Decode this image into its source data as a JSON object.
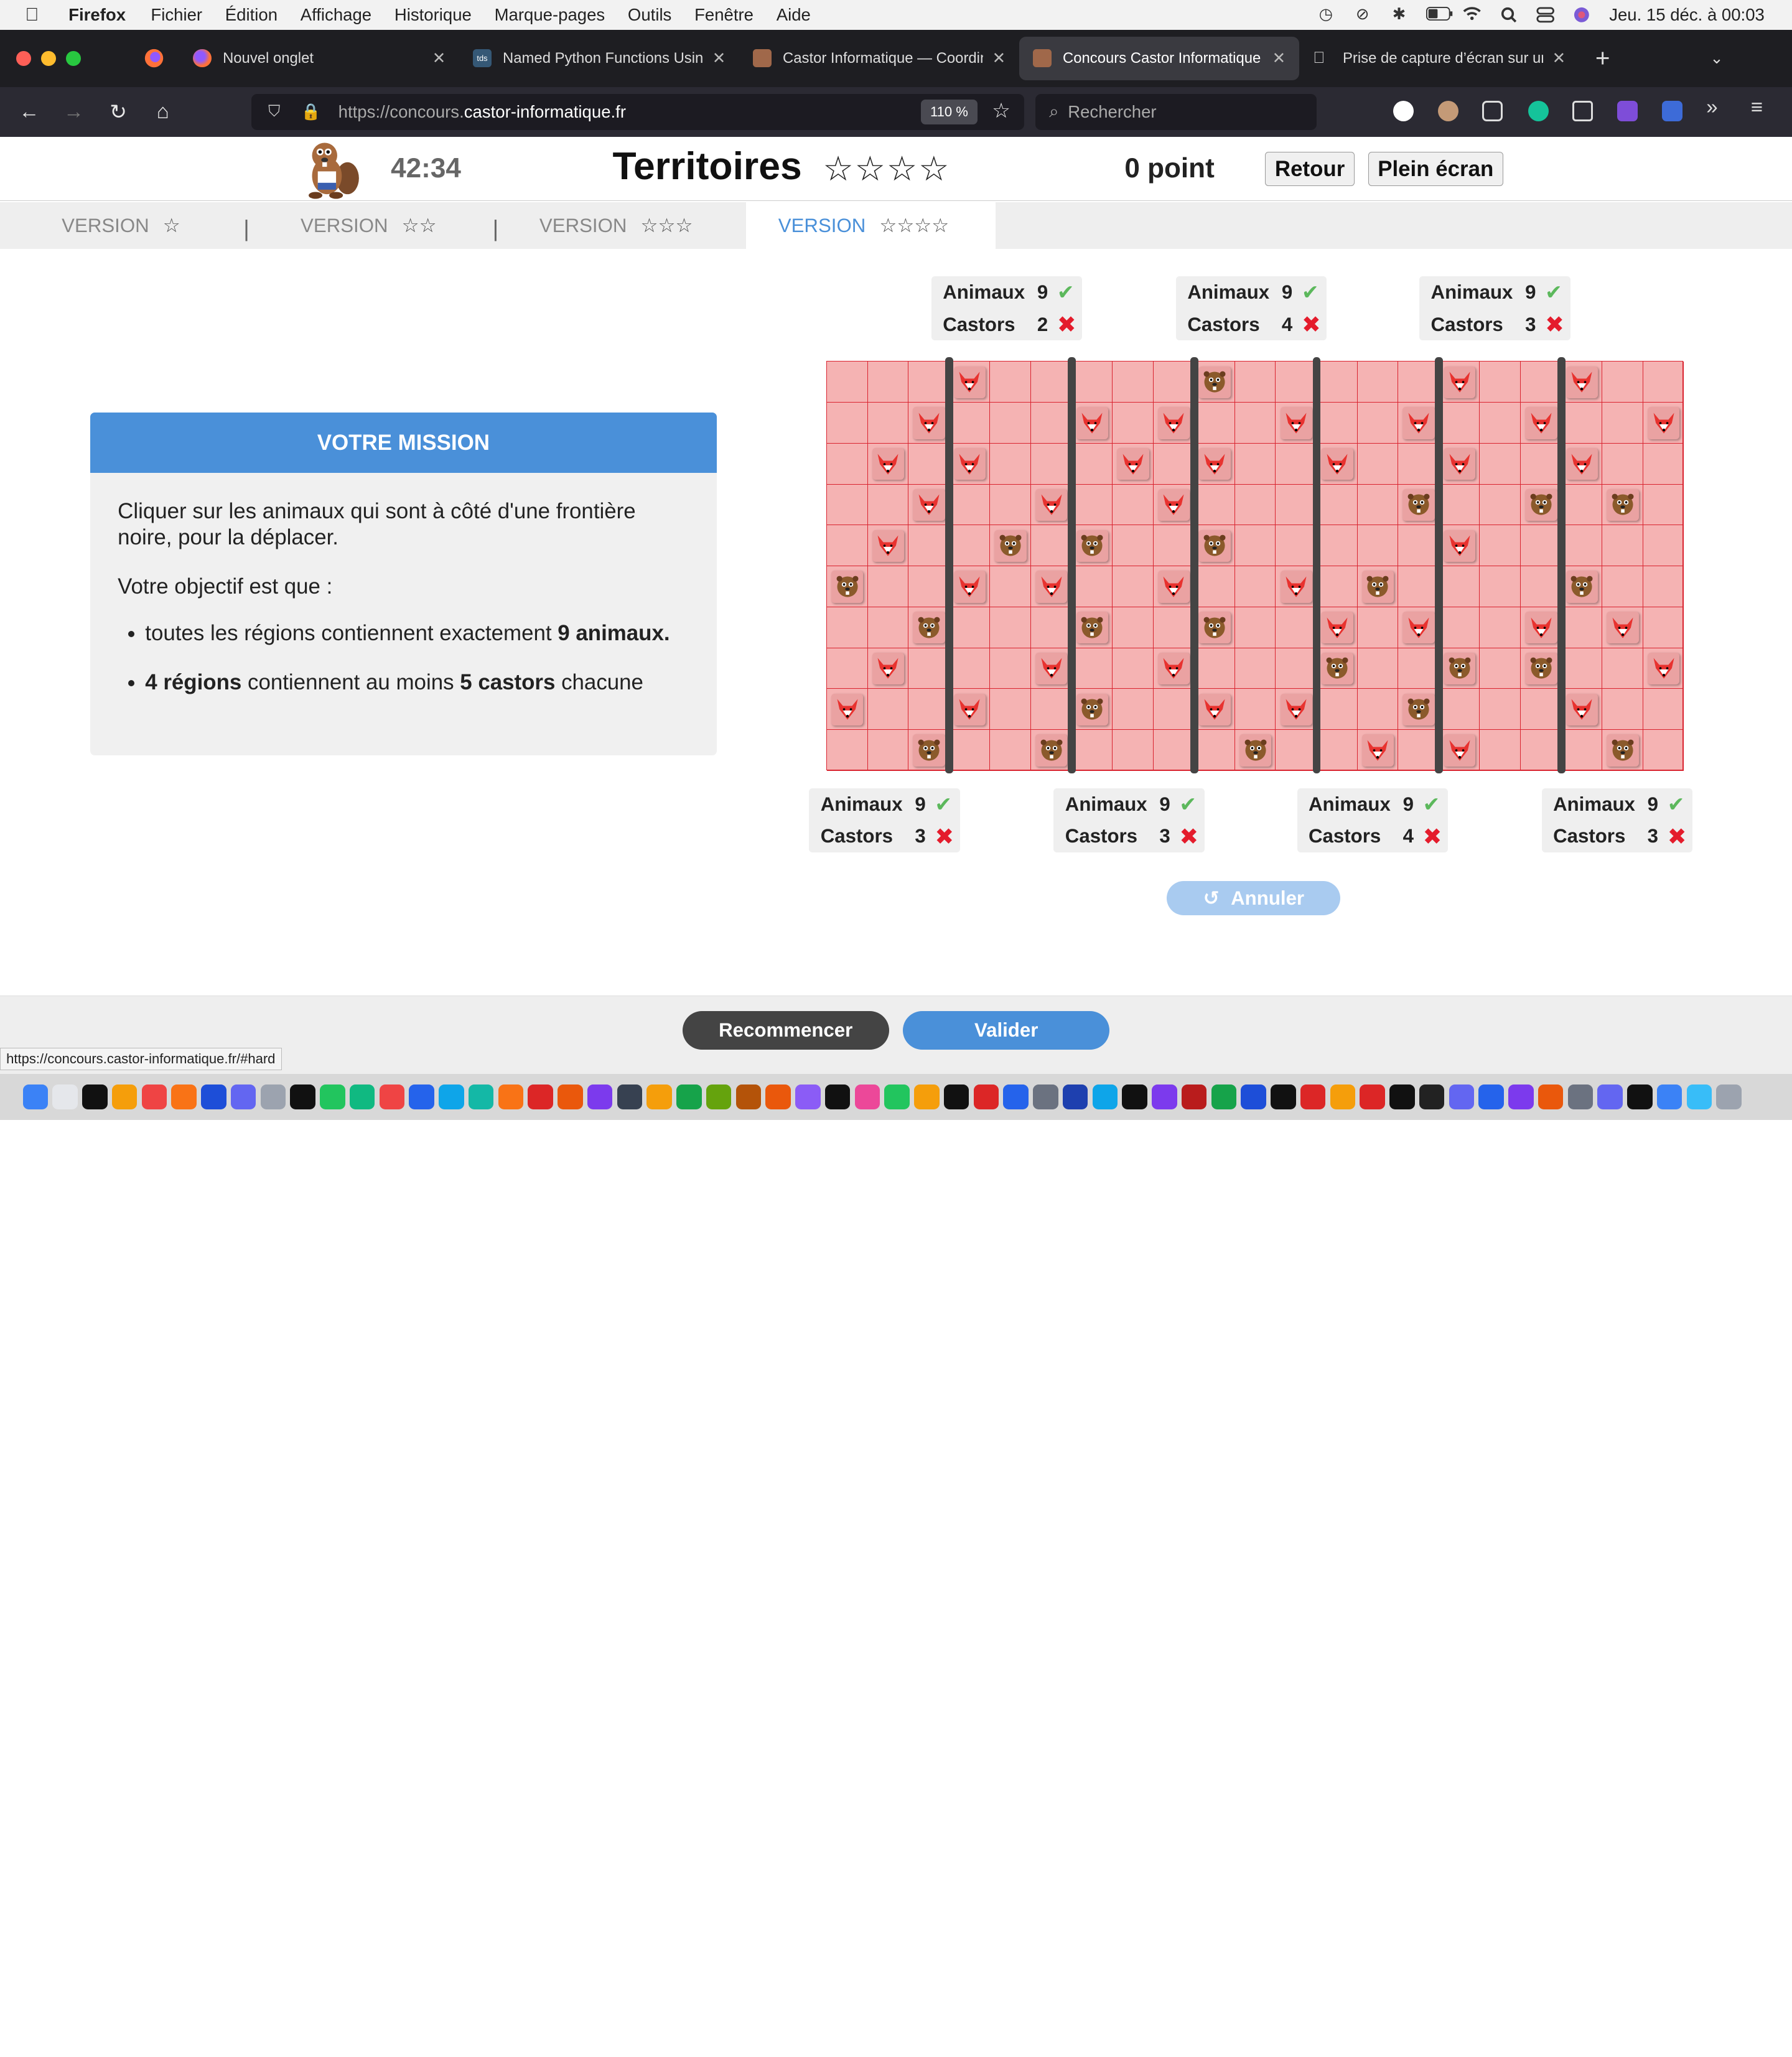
{
  "menubar": {
    "app": "Firefox",
    "items": [
      "Fichier",
      "Édition",
      "Affichage",
      "Historique",
      "Marque-pages",
      "Outils",
      "Fenêtre",
      "Aide"
    ],
    "clock": "Jeu. 15 déc. à  00:03"
  },
  "tabs": [
    {
      "title": "Nouvel onglet",
      "icon": "firefox-icon"
    },
    {
      "title": "Named Python Functions Using",
      "icon": "tds-icon"
    },
    {
      "title": "Castor Informatique — Coordina",
      "icon": "castor-icon"
    },
    {
      "title": "Concours Castor Informatique –",
      "icon": "castor-icon",
      "active": true
    },
    {
      "title": "Prise de capture d’écran sur un",
      "icon": "apple-icon"
    }
  ],
  "navbar": {
    "url_prefix": "https://concours.",
    "url_domain": "castor-informatique.fr",
    "zoom": "110 %",
    "search_placeholder": "Rechercher"
  },
  "header": {
    "timer": "42:34",
    "title": "Territoires",
    "stars": "☆☆☆☆",
    "score": "0 point",
    "back_label": "Retour",
    "fullscreen_label": "Plein écran"
  },
  "version_tabs": [
    {
      "label": "VERSION",
      "stars": "☆"
    },
    {
      "label": "VERSION",
      "stars": "☆☆"
    },
    {
      "label": "VERSION",
      "stars": "☆☆☆"
    },
    {
      "label": "VERSION",
      "stars": "☆☆☆☆",
      "active": true
    }
  ],
  "version_separator": "|",
  "mission": {
    "heading": "VOTRE MISSION",
    "intro": "Cliquer sur les animaux qui sont à côté d'une frontière noire, pour la déplacer.",
    "objective": "Votre objectif est que :",
    "bullet1_a": "toutes les régions contiennent exactement ",
    "bullet1_b": "9 animaux.",
    "bullet2_a": "4 régions",
    "bullet2_b": " contiennent au moins ",
    "bullet2_c": "5 castors",
    "bullet2_d": " chacune"
  },
  "grid": {
    "cols": 21,
    "rows": 10,
    "borders_after_col": [
      3,
      6,
      9,
      12,
      15,
      18
    ],
    "foxes": [
      [
        0,
        3
      ],
      [
        0,
        15
      ],
      [
        0,
        18
      ],
      [
        1,
        2
      ],
      [
        1,
        6
      ],
      [
        1,
        8
      ],
      [
        1,
        11
      ],
      [
        1,
        14
      ],
      [
        1,
        17
      ],
      [
        1,
        20
      ],
      [
        2,
        1
      ],
      [
        2,
        3
      ],
      [
        2,
        7
      ],
      [
        2,
        9
      ],
      [
        2,
        12
      ],
      [
        2,
        15
      ],
      [
        2,
        18
      ],
      [
        3,
        2
      ],
      [
        3,
        5
      ],
      [
        3,
        8
      ],
      [
        4,
        1
      ],
      [
        4,
        15
      ],
      [
        5,
        3
      ],
      [
        5,
        5
      ],
      [
        5,
        8
      ],
      [
        5,
        11
      ],
      [
        6,
        12
      ],
      [
        6,
        14
      ],
      [
        6,
        17
      ],
      [
        6,
        19
      ],
      [
        7,
        1
      ],
      [
        7,
        5
      ],
      [
        7,
        8
      ],
      [
        7,
        20
      ],
      [
        8,
        0
      ],
      [
        8,
        3
      ],
      [
        8,
        9
      ],
      [
        8,
        11
      ],
      [
        8,
        18
      ],
      [
        9,
        13
      ],
      [
        9,
        15
      ]
    ],
    "beavers": [
      [
        0,
        9
      ],
      [
        3,
        14
      ],
      [
        3,
        17
      ],
      [
        3,
        19
      ],
      [
        4,
        4
      ],
      [
        4,
        6
      ],
      [
        4,
        9
      ],
      [
        5,
        0
      ],
      [
        5,
        13
      ],
      [
        5,
        18
      ],
      [
        6,
        2
      ],
      [
        6,
        6
      ],
      [
        6,
        9
      ],
      [
        7,
        12
      ],
      [
        7,
        15
      ],
      [
        7,
        17
      ],
      [
        8,
        6
      ],
      [
        8,
        14
      ],
      [
        9,
        2
      ],
      [
        9,
        5
      ],
      [
        9,
        10
      ],
      [
        9,
        19
      ]
    ]
  },
  "regions_top": [
    {
      "animals_label": "Animaux",
      "animals": "9",
      "castors_label": "Castors",
      "castors": "2",
      "animals_ok": true,
      "castors_ok": false
    },
    {
      "animals_label": "Animaux",
      "animals": "9",
      "castors_label": "Castors",
      "castors": "4",
      "animals_ok": true,
      "castors_ok": false
    },
    {
      "animals_label": "Animaux",
      "animals": "9",
      "castors_label": "Castors",
      "castors": "3",
      "animals_ok": true,
      "castors_ok": false
    }
  ],
  "regions_bottom": [
    {
      "animals_label": "Animaux",
      "animals": "9",
      "castors_label": "Castors",
      "castors": "3",
      "animals_ok": true,
      "castors_ok": false
    },
    {
      "animals_label": "Animaux",
      "animals": "9",
      "castors_label": "Castors",
      "castors": "3",
      "animals_ok": true,
      "castors_ok": false
    },
    {
      "animals_label": "Animaux",
      "animals": "9",
      "castors_label": "Castors",
      "castors": "4",
      "animals_ok": true,
      "castors_ok": false
    },
    {
      "animals_label": "Animaux",
      "animals": "9",
      "castors_label": "Castors",
      "castors": "3",
      "animals_ok": true,
      "castors_ok": false
    }
  ],
  "undo_label": "Annuler",
  "footer": {
    "restart_label": "Recommencer",
    "validate_label": "Valider"
  },
  "status_url": "https://concours.castor-informatique.fr/#hard",
  "colors": {
    "accent": "#4a90d9",
    "grid_bg": "#f5b3b3",
    "grid_line": "#d9232f",
    "ok": "#5cb85c",
    "ko": "#e41c2c"
  }
}
